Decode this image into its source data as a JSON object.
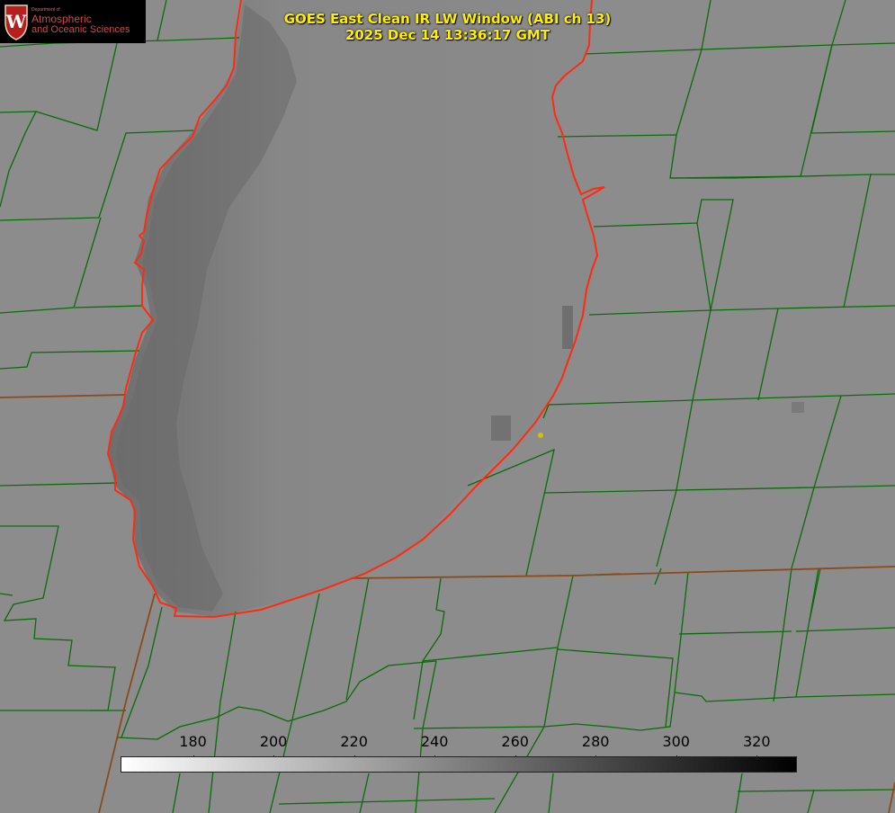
{
  "title": {
    "line1": "GOES East Clean IR LW Window (ABI ch 13)",
    "line2": "2025 Dec 14 13:36:17 GMT"
  },
  "logo": {
    "department": "Department of",
    "line1": "Atmospheric",
    "line2": "and Oceanic Sciences",
    "crest_letter": "W"
  },
  "colorbar": {
    "ticks": [
      "180",
      "200",
      "220",
      "240",
      "260",
      "280",
      "300",
      "320"
    ],
    "min": 162,
    "max": 330,
    "colormap": [
      "#ffffff",
      "#000000"
    ]
  },
  "colors": {
    "background": "#8c8c8c",
    "county_lines": "#0b6b0b",
    "state_lines": "#8b4a1a",
    "shoreline": "#ff2a10",
    "title_text": "#ffee00",
    "marker": "#d4c200"
  }
}
